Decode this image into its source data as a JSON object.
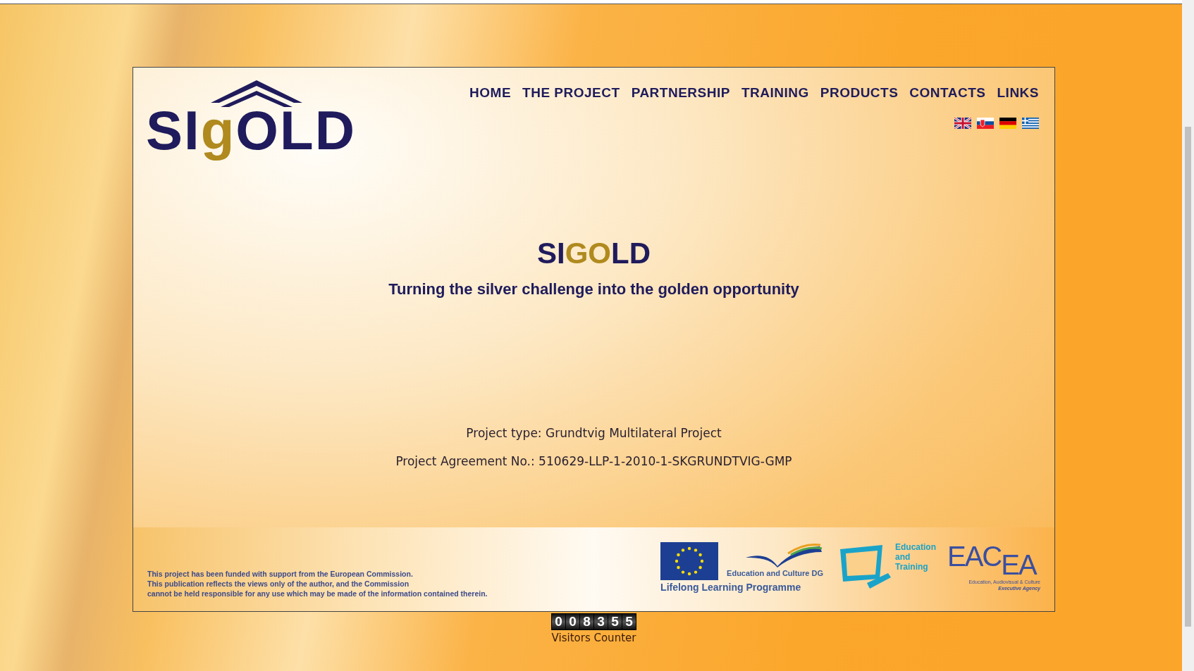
{
  "logo": {
    "parts": [
      {
        "text": "SI",
        "accent": false
      },
      {
        "text": "g",
        "accent": true
      },
      {
        "text": "OLD",
        "accent": false
      }
    ]
  },
  "nav": [
    "HOME",
    "THE PROJECT",
    "PARTNERSHIP",
    "TRAINING",
    "PRODUCTS",
    "CONTACTS",
    "LINKS"
  ],
  "languages": [
    {
      "kind": "uk"
    },
    {
      "kind": "sk"
    },
    {
      "kind": "de"
    },
    {
      "kind": "gr"
    }
  ],
  "hero": {
    "title_parts": [
      {
        "text": "SI",
        "accent": false
      },
      {
        "text": "GO",
        "accent": true
      },
      {
        "text": "LD",
        "accent": false
      }
    ],
    "tagline": "Turning the silver challenge into the golden opportunity"
  },
  "project_info": [
    "Project type: Grundtvig Multilateral Project",
    "Project Agreement No.: 510629-LLP-1-2010-1-SKGRUNDTVIG-GMP"
  ],
  "footer": {
    "disclaimer": [
      "This project has been funded with support from the European Commission.",
      "This publication reflects the views only of the author, and the Commission",
      "cannot be held responsible for any use which may be made of the information contained therein."
    ],
    "dg_label": "Education and Culture DG",
    "llp_label": "Lifelong Learning Programme",
    "et_label": "Education and Training",
    "eacea_a": "EAC",
    "eacea_b": "EA",
    "eacea_line1": "Education, Audiovisual & Culture",
    "eacea_line2": "Executive Agency"
  },
  "counter": {
    "digits": [
      "0",
      "0",
      "8",
      "3",
      "5",
      "5"
    ],
    "label": "Visitors Counter"
  }
}
